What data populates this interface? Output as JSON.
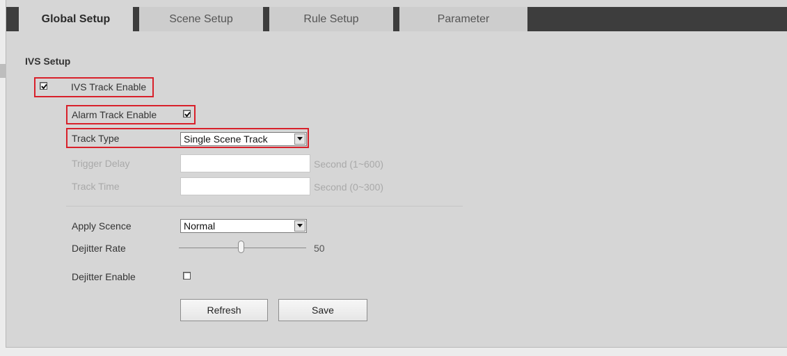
{
  "tabs": [
    {
      "label": "Global Setup",
      "active": true
    },
    {
      "label": "Scene Setup",
      "active": false
    },
    {
      "label": "Rule Setup",
      "active": false
    },
    {
      "label": "Parameter",
      "active": false
    }
  ],
  "section_title": "IVS Setup",
  "ivs_track_enable": {
    "label": "IVS Track Enable",
    "checked": true
  },
  "alarm_track_enable": {
    "label": "Alarm Track Enable",
    "checked": true
  },
  "track_type": {
    "label": "Track Type",
    "value": "Single Scene Track"
  },
  "trigger_delay": {
    "label": "Trigger Delay",
    "value": "",
    "unit": "Second (1~600)"
  },
  "track_time": {
    "label": "Track Time",
    "value": "",
    "unit": "Second (0~300)"
  },
  "apply_scence": {
    "label": "Apply Scence",
    "value": "Normal"
  },
  "dejitter_rate": {
    "label": "Dejitter Rate",
    "value": "50",
    "min": 0,
    "max": 100
  },
  "dejitter_enable": {
    "label": "Dejitter Enable",
    "checked": false
  },
  "buttons": {
    "refresh": "Refresh",
    "save": "Save"
  },
  "colors": {
    "highlight": "#d8202a",
    "tab_strip": "#3d3d3d",
    "background": "#d6d6d6"
  }
}
